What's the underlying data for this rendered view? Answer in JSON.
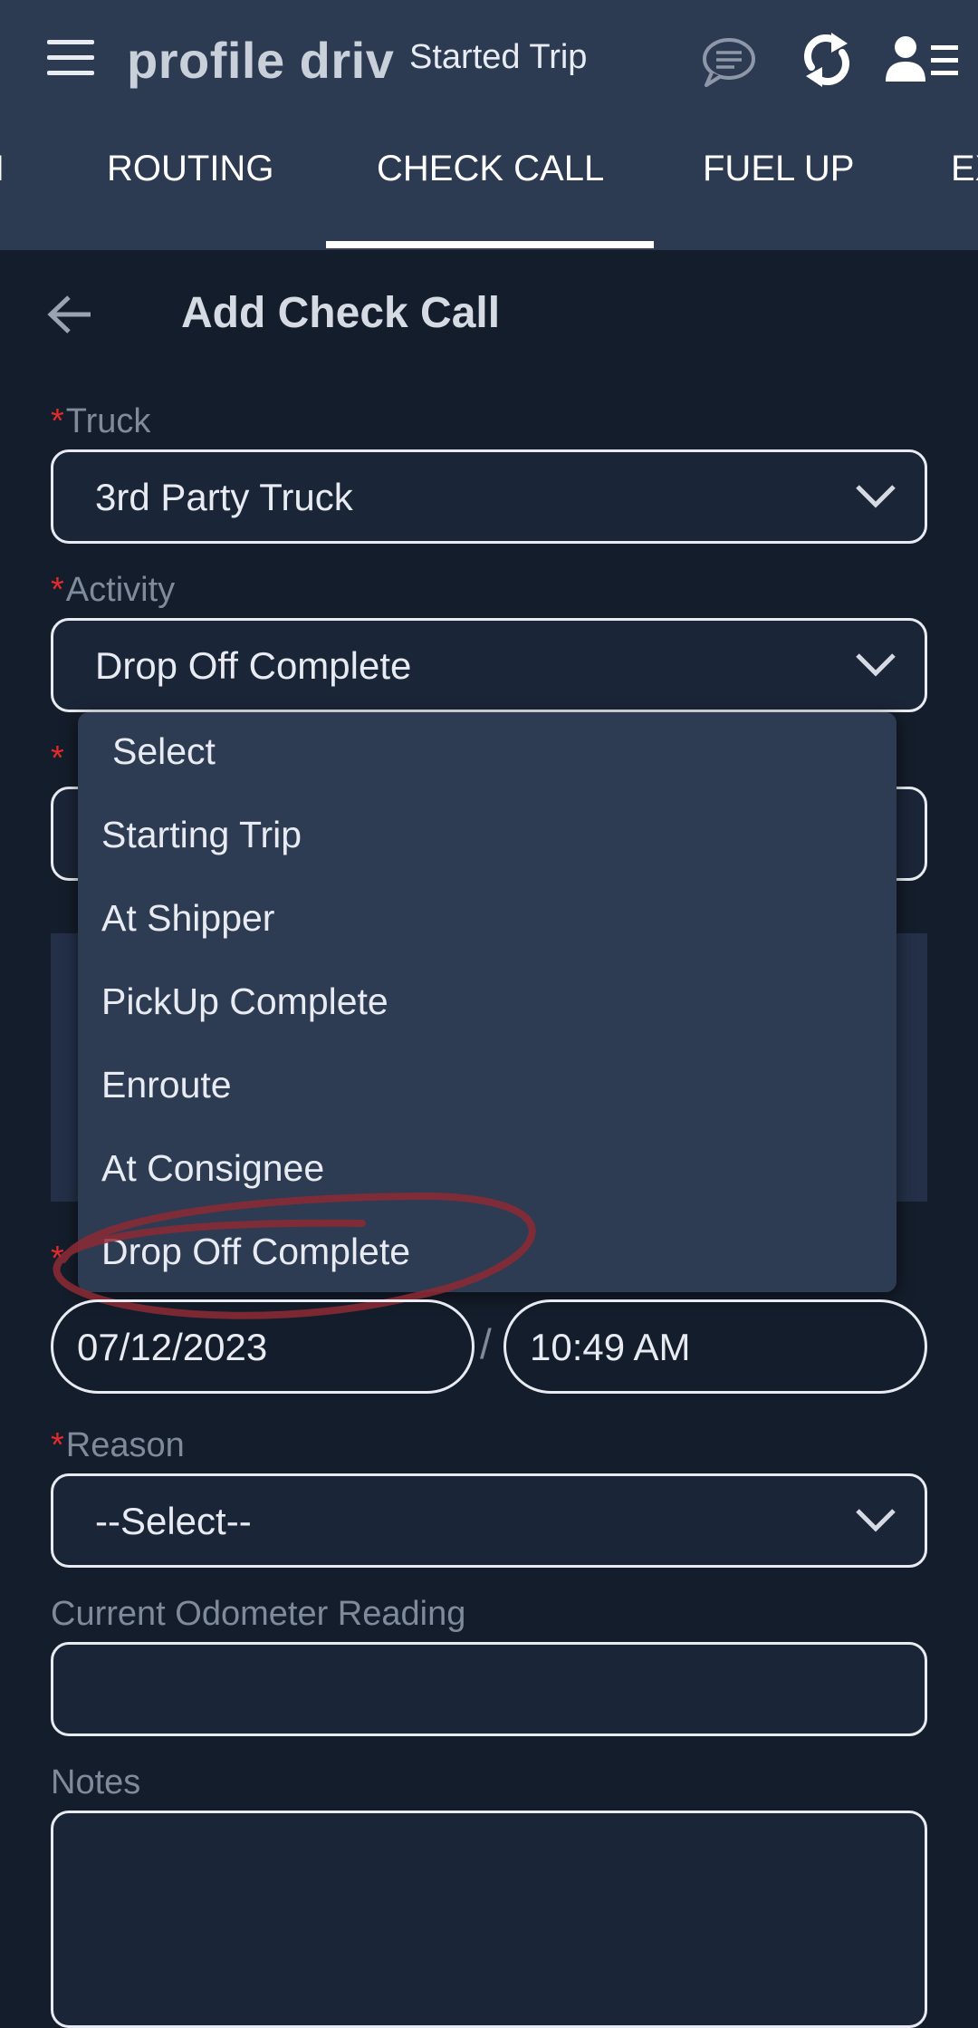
{
  "header": {
    "app_title": "profile driv",
    "trip_status": "Started Trip",
    "icons": [
      "menu-icon",
      "chat-icon",
      "sync-icon",
      "profile-icon"
    ]
  },
  "tabs": [
    {
      "label": "I"
    },
    {
      "label": "ROUTING"
    },
    {
      "label": "CHECK CALL",
      "active": true
    },
    {
      "label": "FUEL UP"
    },
    {
      "label": "EX"
    }
  ],
  "page": {
    "title": "Add Check Call"
  },
  "form": {
    "required_mark": "*",
    "truck": {
      "label": "Truck",
      "value": "3rd Party Truck"
    },
    "activity": {
      "label": "Activity",
      "value": "Drop Off Complete"
    },
    "activity_options": [
      "Select",
      "Starting Trip",
      "At Shipper",
      "PickUp Complete",
      "Enroute",
      "At Consignee",
      "Drop Off Complete"
    ],
    "datetime": {
      "date": "07/12/2023",
      "separator": "/",
      "time": "10:49 AM"
    },
    "reason": {
      "label": "Reason",
      "value": "--Select--"
    },
    "odometer": {
      "label": "Current Odometer Reading",
      "value": ""
    },
    "notes": {
      "label": "Notes",
      "value": ""
    }
  },
  "colors": {
    "header_bg": "#2c3a52",
    "page_bg": "#141d2b",
    "dropdown_bg": "#2d3b53",
    "required": "#e02b2b",
    "annotation": "#8e2a35"
  }
}
